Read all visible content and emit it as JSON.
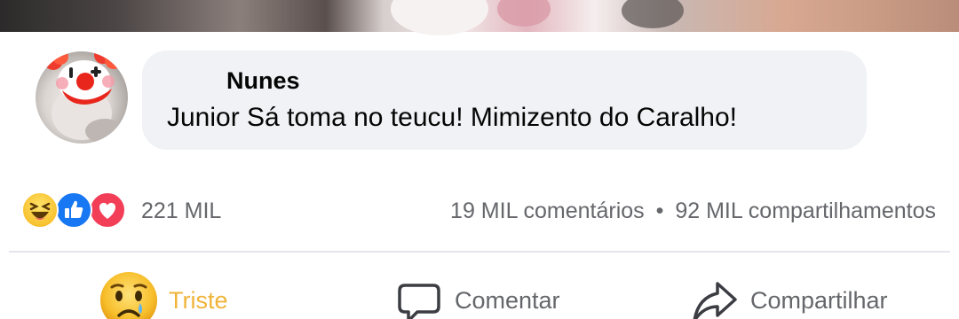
{
  "comment": {
    "author": "Nunes",
    "text": "Junior Sá toma no teucu! Mimizento do Caralho!"
  },
  "reactions": {
    "icons": [
      "haha-icon",
      "like-icon",
      "love-icon"
    ],
    "count": "221 MIL"
  },
  "stats": {
    "comments": "19 MIL comentários",
    "separator": "•",
    "shares": "92 MIL compartilhamentos"
  },
  "actions": {
    "reaction_label": "Triste",
    "comment_label": "Comentar",
    "share_label": "Compartilhar"
  },
  "colors": {
    "bubble": "#f0f2f5",
    "secondary_text": "#65676b",
    "sad_reaction": "#f0b43a",
    "like_blue": "#1877f2",
    "love_red": "#f33e58"
  }
}
